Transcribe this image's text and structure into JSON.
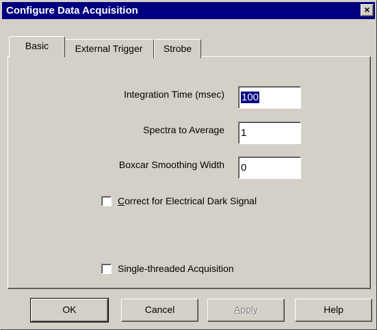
{
  "window": {
    "title": "Configure Data Acquisition",
    "close_glyph": "×"
  },
  "tabs": [
    {
      "label": "Basic",
      "active": true
    },
    {
      "label": "External Trigger",
      "active": false
    },
    {
      "label": "Strobe",
      "active": false
    }
  ],
  "fields": {
    "integration_time": {
      "label": "Integration Time (msec)",
      "value": "100"
    },
    "spectra_to_average": {
      "label": "Spectra to Average",
      "value": "1"
    },
    "boxcar_width": {
      "label": "Boxcar Smoothing Width",
      "value": "0"
    }
  },
  "checkboxes": {
    "correct_dark": {
      "label_underlined": "C",
      "label_rest": "orrect for Electrical Dark Signal",
      "checked": false
    },
    "single_threaded": {
      "label": "Single-threaded Acquisition",
      "checked": false
    }
  },
  "buttons": {
    "ok": "OK",
    "cancel": "Cancel",
    "apply": "Apply",
    "help": "Help"
  },
  "colors": {
    "title_bar": "#000080",
    "face": "#d4d0c8",
    "selection": "#000080"
  },
  "icons": {
    "close": "close-icon"
  }
}
